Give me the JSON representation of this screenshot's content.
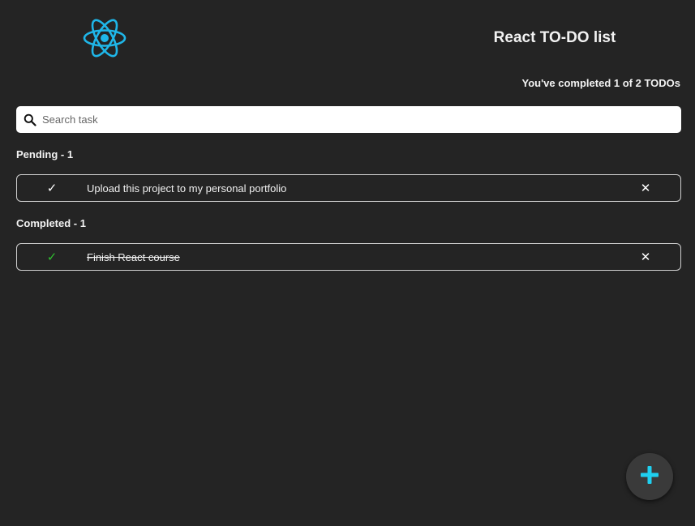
{
  "header": {
    "title": "React TO-DO list",
    "logo_icon": "react-atom-icon",
    "accent_color": "#1fb6e8"
  },
  "counter": {
    "text": "You've completed 1 of 2 TODOs"
  },
  "search": {
    "placeholder": "Search task",
    "value": "",
    "icon": "search-icon"
  },
  "sections": {
    "pending": {
      "heading": "Pending - 1",
      "items": [
        {
          "text": "Upload this project to my personal portfolio",
          "completed": false
        }
      ]
    },
    "completed": {
      "heading": "Completed - 1",
      "items": [
        {
          "text": "Finish React course",
          "completed": true
        }
      ]
    }
  },
  "icons": {
    "check": "✓",
    "delete": "✕",
    "check_done_color": "#2fbf2f"
  },
  "fab": {
    "icon": "plus-icon",
    "color": "#1fd0f0"
  }
}
